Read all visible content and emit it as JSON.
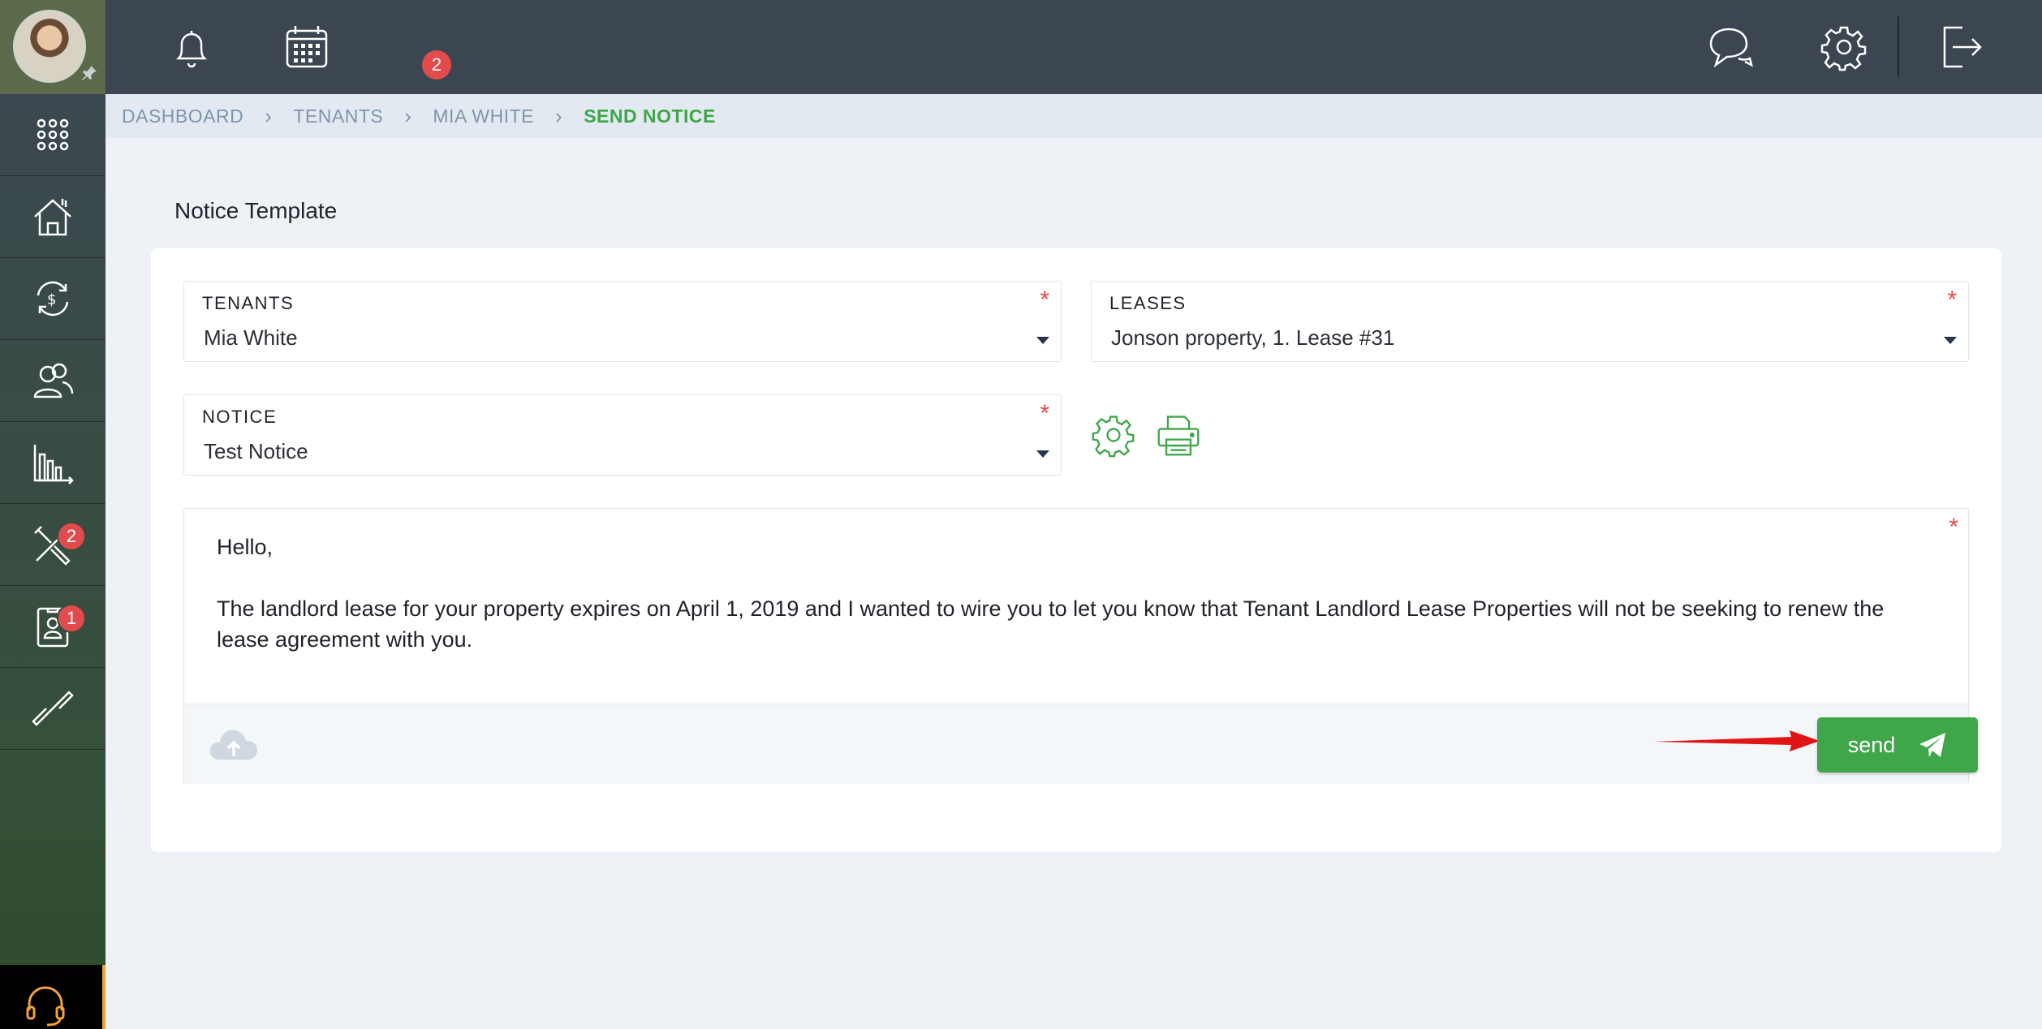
{
  "sidebar": {
    "items": [
      {
        "name": "apps",
        "icon": "apps-grid-icon"
      },
      {
        "name": "properties",
        "icon": "house-icon"
      },
      {
        "name": "payments",
        "icon": "dollar-cycle-icon"
      },
      {
        "name": "tenants",
        "icon": "users-icon"
      },
      {
        "name": "reports",
        "icon": "bar-chart-icon"
      },
      {
        "name": "maintenance",
        "icon": "tools-icon",
        "badge": "2"
      },
      {
        "name": "applicants",
        "icon": "id-card-icon",
        "badge": "1"
      },
      {
        "name": "integrations",
        "icon": "link-icon"
      }
    ]
  },
  "topbar": {
    "calendar_badge": "2"
  },
  "breadcrumb": [
    "DASHBOARD",
    "TENANTS",
    "MIA WHITE",
    "SEND NOTICE"
  ],
  "page": {
    "title": "Notice Template"
  },
  "form": {
    "tenants": {
      "label": "TENANTS",
      "value": "Mia White"
    },
    "leases": {
      "label": "LEASES",
      "value": "Jonson property, 1. Lease #31"
    },
    "notice": {
      "label": "NOTICE",
      "value": "Test Notice"
    },
    "required_mark": "*"
  },
  "editor": {
    "greeting": "Hello,",
    "body": "The landlord lease for your property expires on April 1, 2019 and I wanted to wire you to let you know that Tenant Landlord Lease Properties will not be seeking to renew the lease agreement with you."
  },
  "send_button": {
    "label": "send"
  },
  "colors": {
    "accent": "#3fa64a",
    "topbar": "#3c4651",
    "badge": "#e24b4b",
    "required": "#e24b4b",
    "arrow": "#e01515"
  }
}
